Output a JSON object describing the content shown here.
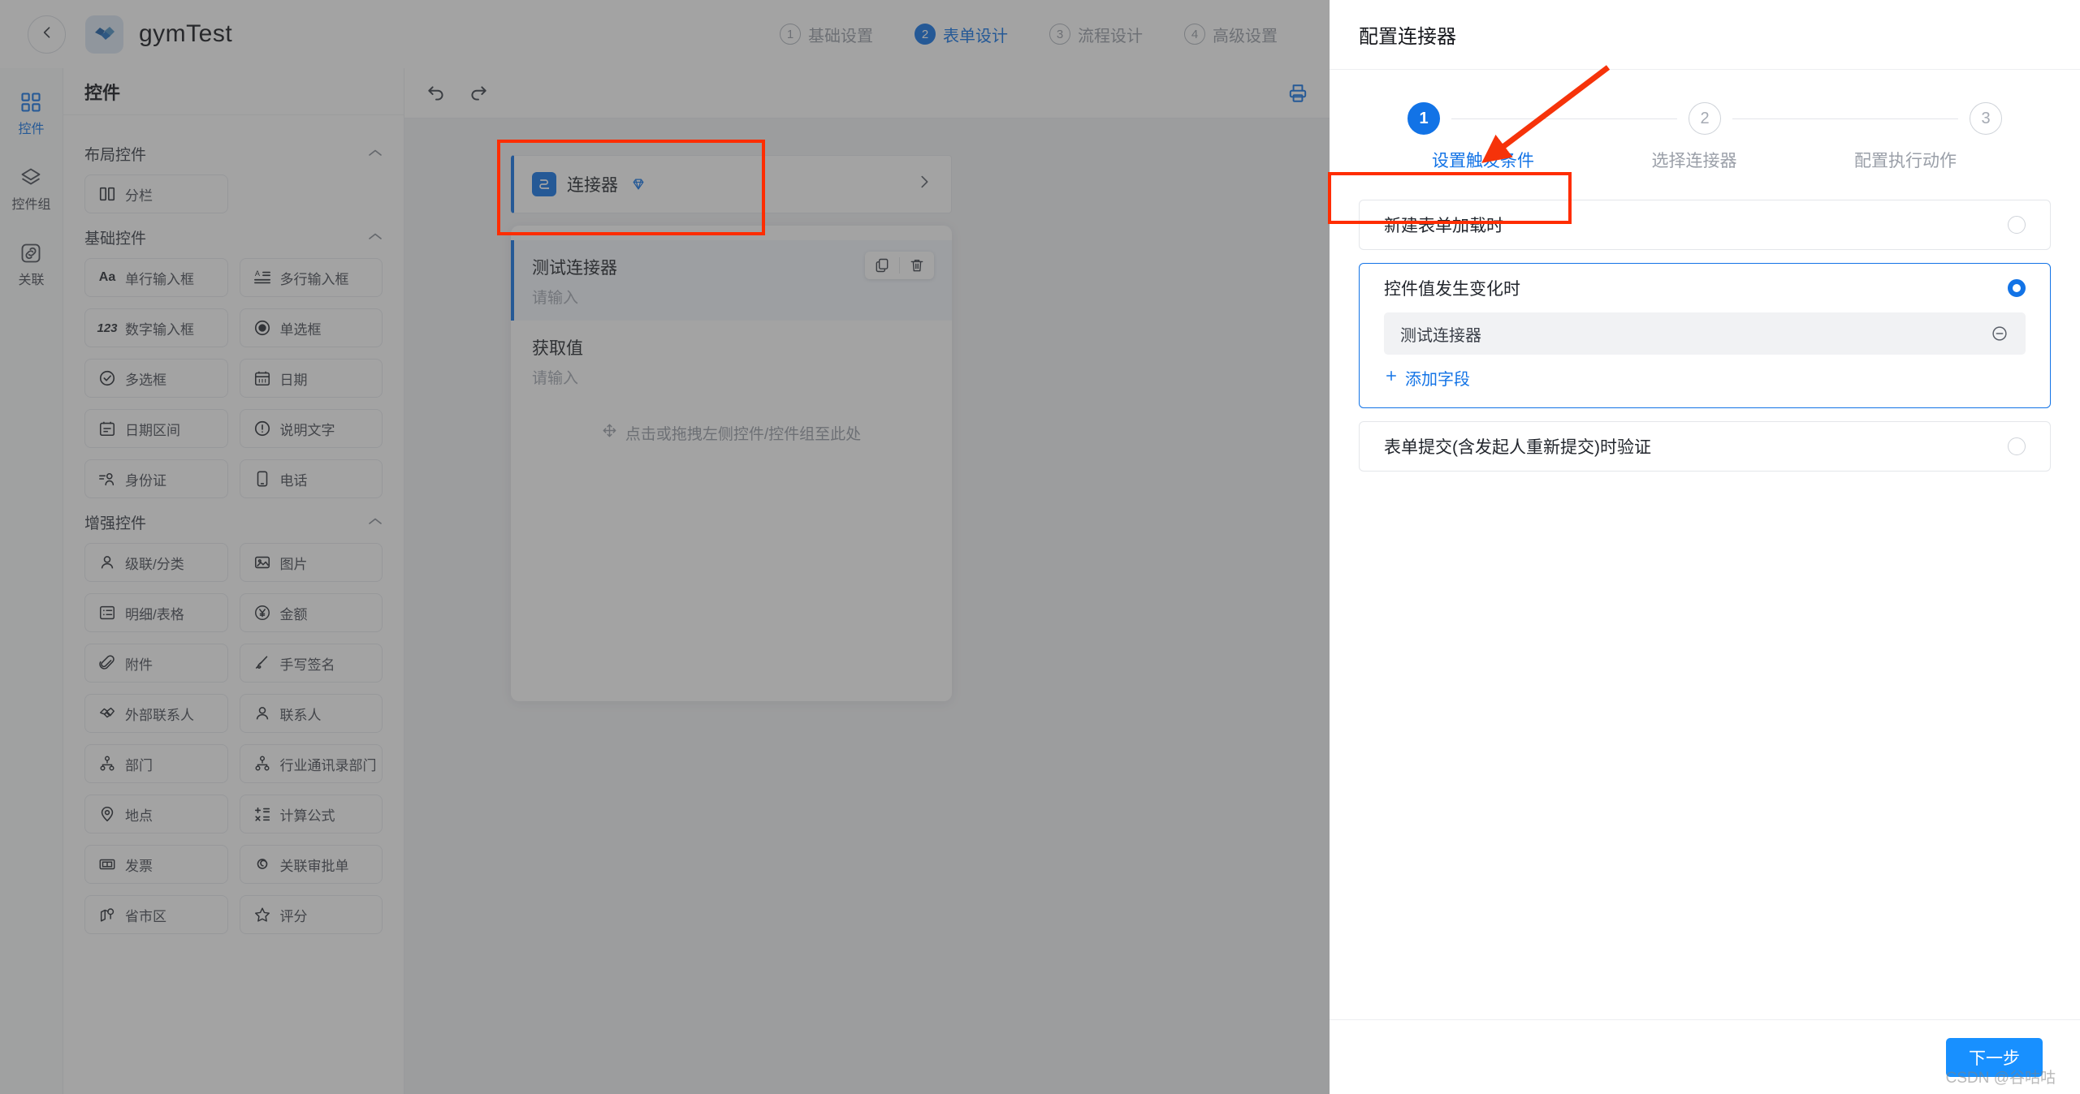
{
  "topbar": {
    "back_icon": "chevron-left-icon",
    "logo_icon": "handshake-logo-icon",
    "app_title": "gymTest",
    "steps": [
      {
        "num": "1",
        "label": "基础设置",
        "active": false
      },
      {
        "num": "2",
        "label": "表单设计",
        "active": true
      },
      {
        "num": "3",
        "label": "流程设计",
        "active": false
      },
      {
        "num": "4",
        "label": "高级设置",
        "active": false
      }
    ]
  },
  "rail": {
    "items": [
      {
        "label": "控件",
        "icon": "grid-icon",
        "active": true
      },
      {
        "label": "控件组",
        "icon": "layers-icon",
        "active": false
      },
      {
        "label": "关联",
        "icon": "link-icon",
        "active": false
      }
    ]
  },
  "panel": {
    "title": "控件",
    "groups": [
      {
        "title": "布局控件",
        "chevron": "chevron-up-icon",
        "items": [
          {
            "label": "分栏",
            "icon": "columns-icon"
          }
        ]
      },
      {
        "title": "基础控件",
        "chevron": "chevron-up-icon",
        "items": [
          {
            "label": "单行输入框",
            "icon": "text-aa-icon"
          },
          {
            "label": "多行输入框",
            "icon": "textarea-icon"
          },
          {
            "label": "数字输入框",
            "icon": "number-123-icon"
          },
          {
            "label": "单选框",
            "icon": "radio-icon"
          },
          {
            "label": "多选框",
            "icon": "check-circle-icon"
          },
          {
            "label": "日期",
            "icon": "calendar-icon"
          },
          {
            "label": "日期区间",
            "icon": "calendar-range-icon"
          },
          {
            "label": "说明文字",
            "icon": "exclamation-circle-icon"
          },
          {
            "label": "身份证",
            "icon": "id-card-icon"
          },
          {
            "label": "电话",
            "icon": "phone-icon"
          }
        ]
      },
      {
        "title": "增强控件",
        "chevron": "chevron-up-icon",
        "items": [
          {
            "label": "级联/分类",
            "icon": "person-icon"
          },
          {
            "label": "图片",
            "icon": "image-icon"
          },
          {
            "label": "明细/表格",
            "icon": "table-icon"
          },
          {
            "label": "金额",
            "icon": "yuan-circle-icon"
          },
          {
            "label": "附件",
            "icon": "paperclip-icon"
          },
          {
            "label": "手写签名",
            "icon": "signature-icon"
          },
          {
            "label": "外部联系人",
            "icon": "handshake-icon"
          },
          {
            "label": "联系人",
            "icon": "contact-icon"
          },
          {
            "label": "部门",
            "icon": "org-tree-icon"
          },
          {
            "label": "行业通讯录部门",
            "icon": "org-tree-icon"
          },
          {
            "label": "地点",
            "icon": "location-pin-icon"
          },
          {
            "label": "计算公式",
            "icon": "formula-icon"
          },
          {
            "label": "发票",
            "icon": "invoice-icon"
          },
          {
            "label": "关联审批单",
            "icon": "link-loop-icon"
          },
          {
            "label": "省市区",
            "icon": "map-pin-icon"
          },
          {
            "label": "评分",
            "icon": "star-icon"
          }
        ]
      }
    ]
  },
  "canvas": {
    "toolbar": {
      "undo_icon": "undo-icon",
      "redo_icon": "redo-icon",
      "print_icon": "print-icon"
    },
    "connector_bar": {
      "icon": "connector-icon",
      "label": "连接器",
      "badge_icon": "diamond-icon",
      "arrow_icon": "chevron-right-icon"
    },
    "fields": [
      {
        "label": "测试连接器",
        "placeholder": "请输入",
        "selected": true,
        "actions": [
          {
            "icon": "copy-icon",
            "name": "copy-field-button"
          },
          {
            "icon": "trash-icon",
            "name": "delete-field-button"
          }
        ]
      },
      {
        "label": "获取值",
        "placeholder": "请输入",
        "selected": false,
        "actions": []
      }
    ],
    "dropzone": {
      "icon": "move-arrows-icon",
      "text": "点击或拖拽左侧控件/控件组至此处"
    }
  },
  "drawer": {
    "title": "配置连接器",
    "steps": [
      {
        "num": "1",
        "label": "设置触发条件",
        "active": true
      },
      {
        "num": "2",
        "label": "选择连接器",
        "active": false
      },
      {
        "num": "3",
        "label": "配置执行动作",
        "active": false
      }
    ],
    "options": [
      {
        "title": "新建表单加载时",
        "selected": false,
        "expanded": false
      },
      {
        "title": "控件值发生变化时",
        "selected": true,
        "expanded": true,
        "fields": [
          {
            "label": "测试连接器",
            "remove_icon": "minus-circle-icon"
          }
        ],
        "add_field_label": "添加字段",
        "add_field_icon": "plus-icon"
      },
      {
        "title": "表单提交(含发起人重新提交)时验证",
        "selected": false,
        "expanded": false
      }
    ],
    "footer": {
      "next_label": "下一步"
    }
  },
  "annotations": {
    "watermark": "CSDN @谷咕咕",
    "accent_red": "#ff2d00",
    "accent_blue": "#1273e6"
  }
}
